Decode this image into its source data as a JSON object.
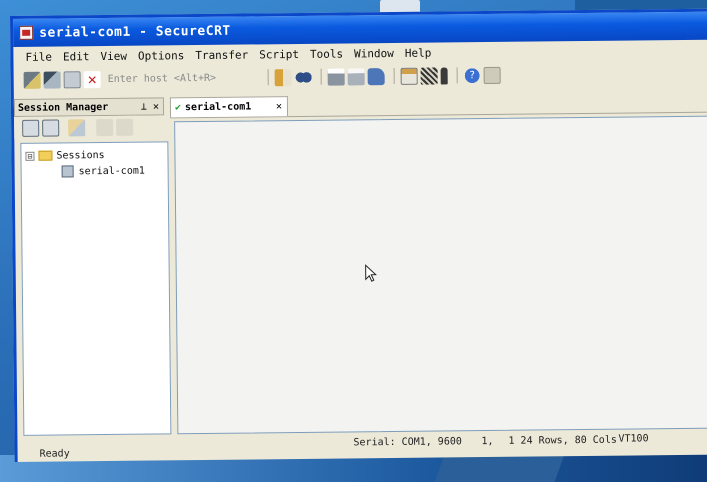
{
  "window": {
    "title": "serial-com1 - SecureCRT"
  },
  "menu": [
    "File",
    "Edit",
    "View",
    "Options",
    "Transfer",
    "Script",
    "Tools",
    "Window",
    "Help"
  ],
  "toolbar": {
    "host_placeholder": "Enter host <Alt+R>",
    "icons_left": [
      "connect-icon",
      "quick-connect-icon",
      "reconnect-icon",
      "disconnect-icon"
    ],
    "icons_right": [
      "copy-icon",
      "find-icon",
      "print-icon",
      "print-selection-icon",
      "print-setup-icon",
      "session-options-icon",
      "keymap-icon",
      "sftp-icon",
      "help-icon",
      "lock-icon"
    ]
  },
  "session_manager": {
    "title": "Session Manager",
    "pin_glyph": "⊥",
    "close_glyph": "✕",
    "tree": {
      "root": {
        "expander": "⊟",
        "label": "Sessions"
      },
      "children": [
        {
          "label": "serial-com1"
        }
      ]
    }
  },
  "tabs": [
    {
      "label": "serial-com1",
      "status_glyph": "✔",
      "close_glyph": "✕"
    }
  ],
  "status": {
    "ready": "Ready",
    "serial": "Serial: COM1, 9600",
    "position": "1,",
    "size": "1 24 Rows, 80 Cols",
    "terminal": "VT100"
  },
  "colors": {
    "titlebar": "#0a5ae0",
    "window_bg": "#ece9d8",
    "terminal_bg": "#f3f3f1"
  }
}
